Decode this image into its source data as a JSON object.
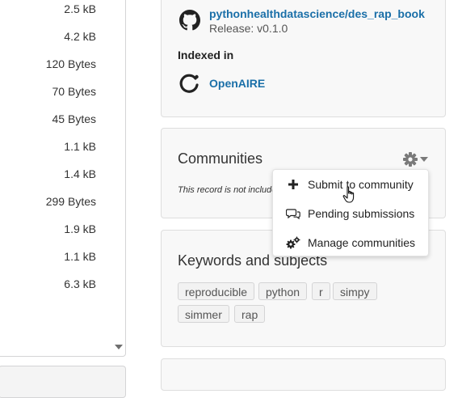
{
  "files": {
    "sizes": [
      "2.5 kB",
      "4.2 kB",
      "120 Bytes",
      "70 Bytes",
      "45 Bytes",
      "1.1 kB",
      "1.4 kB",
      "299 Bytes",
      "1.9 kB",
      "1.1 kB",
      "6.3 kB"
    ]
  },
  "software": {
    "repo_name": "pythonhealthdatascience/des_rap_book",
    "release": "Release: v0.1.0"
  },
  "indexed": {
    "label": "Indexed in",
    "service": "OpenAIRE"
  },
  "communities": {
    "title": "Communities",
    "empty_text": "This record is not included in any communities yet.",
    "menu": [
      {
        "label": "Submit to community",
        "icon": "plus-icon"
      },
      {
        "label": "Pending submissions",
        "icon": "comments-icon"
      },
      {
        "label": "Manage communities",
        "icon": "cogs-icon"
      }
    ]
  },
  "keywords": {
    "title": "Keywords and subjects",
    "items": [
      "reproducible",
      "python",
      "r",
      "simpy",
      "simmer",
      "rap"
    ]
  },
  "colors": {
    "link": "#1a6fa8",
    "card_bg": "#f8f8f8",
    "tag_bg": "#f2f2f2"
  }
}
